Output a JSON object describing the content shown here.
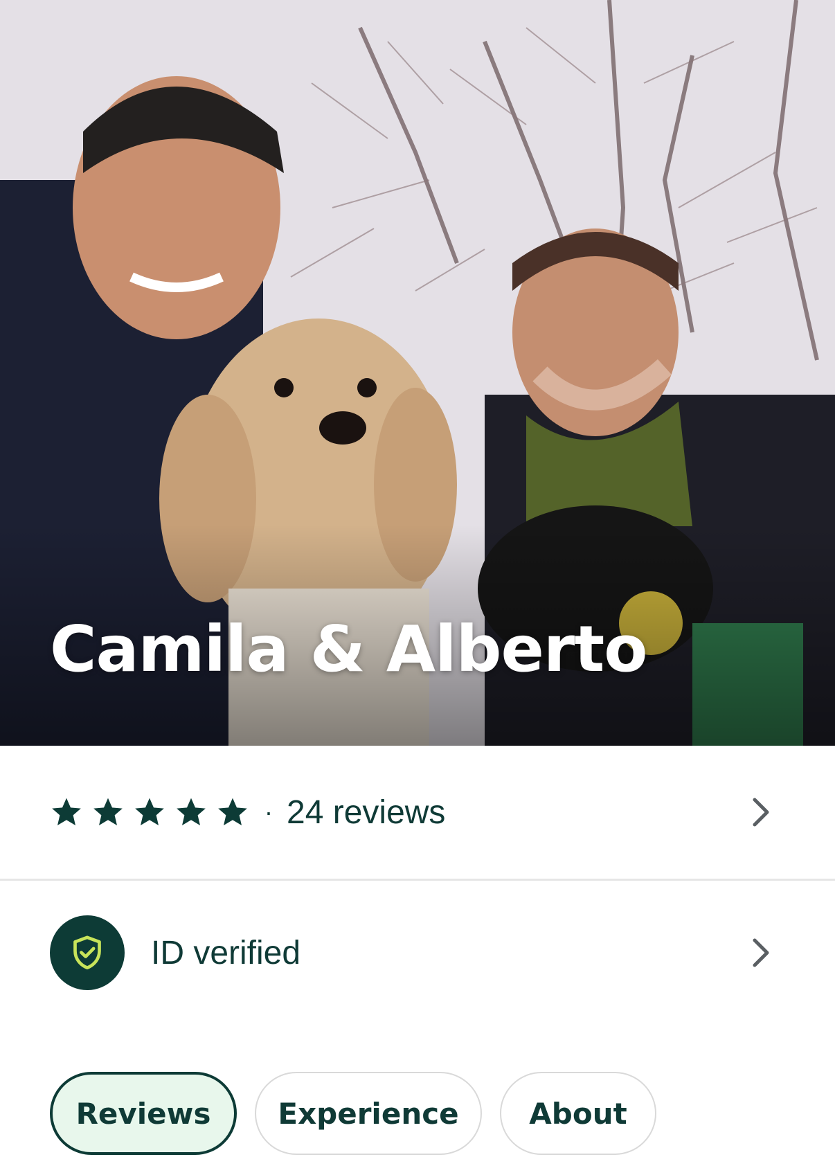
{
  "profile": {
    "name": "Camila & Alberto"
  },
  "rating": {
    "stars": 5,
    "max_stars": 5,
    "separator": "·",
    "reviews_label": "24 reviews"
  },
  "verification": {
    "label": "ID verified"
  },
  "tabs": [
    {
      "label": "Reviews",
      "active": true
    },
    {
      "label": "Experience",
      "active": false
    },
    {
      "label": "About",
      "active": false
    }
  ],
  "colors": {
    "primary": "#0d3b36",
    "accent": "#c8e45a",
    "active_tab_bg": "#e8f7ec",
    "divider": "#e6e6e6"
  },
  "icons": {
    "star": "star-icon",
    "chevron": "chevron-right-icon",
    "shield": "shield-check-icon"
  }
}
